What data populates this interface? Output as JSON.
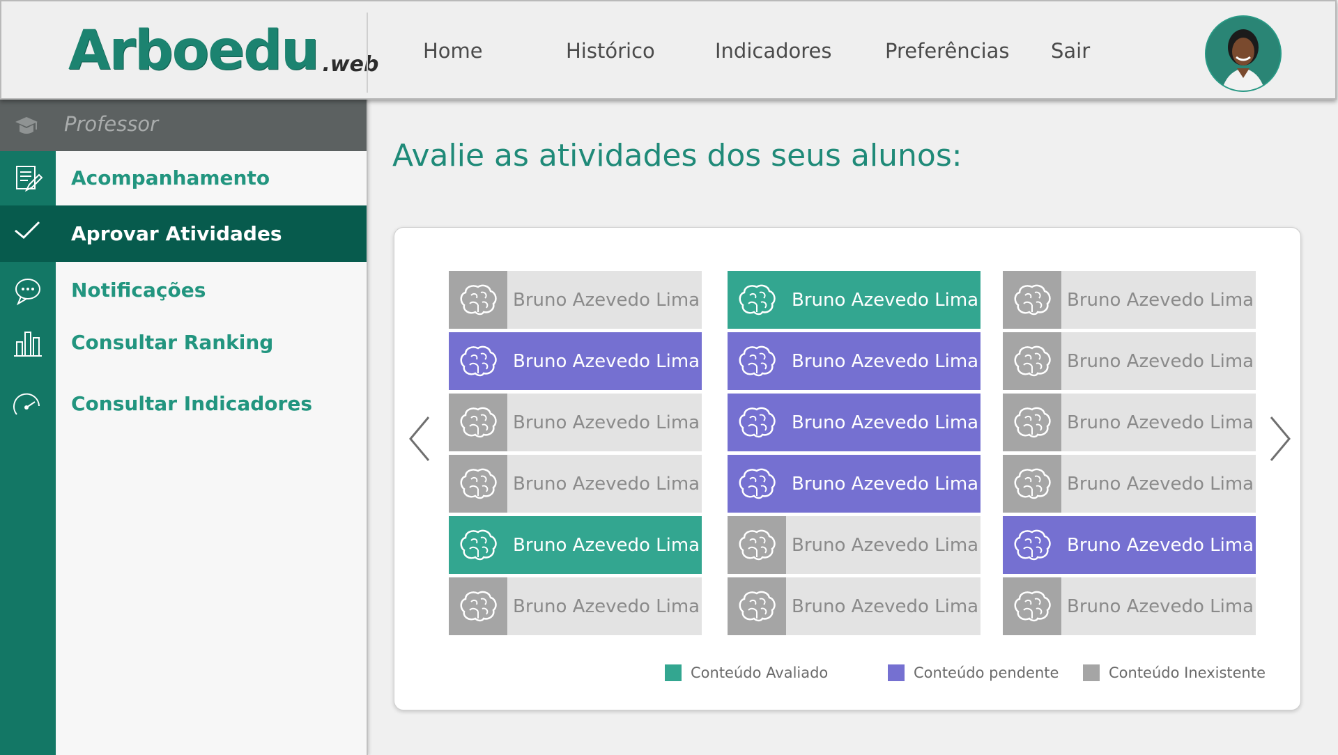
{
  "header": {
    "logo_main": "Arboedu",
    "logo_suffix": ".web",
    "nav": [
      "Home",
      "Histórico",
      "Indicadores",
      "Preferências",
      "Sair"
    ]
  },
  "sidebar": {
    "role": "Professor",
    "items": [
      {
        "label": "Acompanhamento",
        "icon": "edit-document-icon"
      },
      {
        "label": "Aprovar Atividades",
        "icon": "checkmark-icon"
      },
      {
        "label": "Notificações",
        "icon": "chat-bubble-icon"
      },
      {
        "label": "Consultar Ranking",
        "icon": "bar-chart-icon"
      },
      {
        "label": "Consultar Indicadores",
        "icon": "gauge-icon"
      }
    ]
  },
  "main": {
    "title": "Avalie as atividades dos seus alunos:",
    "columns": [
      [
        {
          "name": "Bruno Azevedo Lima",
          "status": "inexistente"
        },
        {
          "name": "Bruno Azevedo Lima",
          "status": "pendente"
        },
        {
          "name": "Bruno Azevedo Lima",
          "status": "inexistente"
        },
        {
          "name": "Bruno Azevedo Lima",
          "status": "inexistente"
        },
        {
          "name": "Bruno Azevedo Lima",
          "status": "avaliado"
        },
        {
          "name": "Bruno Azevedo Lima",
          "status": "inexistente"
        }
      ],
      [
        {
          "name": "Bruno Azevedo Lima",
          "status": "avaliado"
        },
        {
          "name": "Bruno Azevedo Lima",
          "status": "pendente"
        },
        {
          "name": "Bruno Azevedo Lima",
          "status": "pendente"
        },
        {
          "name": "Bruno Azevedo Lima",
          "status": "pendente"
        },
        {
          "name": "Bruno Azevedo Lima",
          "status": "inexistente"
        },
        {
          "name": "Bruno Azevedo Lima",
          "status": "inexistente"
        }
      ],
      [
        {
          "name": "Bruno Azevedo Lima",
          "status": "inexistente"
        },
        {
          "name": "Bruno Azevedo Lima",
          "status": "inexistente"
        },
        {
          "name": "Bruno Azevedo Lima",
          "status": "inexistente"
        },
        {
          "name": "Bruno Azevedo Lima",
          "status": "inexistente"
        },
        {
          "name": "Bruno Azevedo Lima",
          "status": "pendente"
        },
        {
          "name": "Bruno Azevedo Lima",
          "status": "inexistente"
        }
      ]
    ],
    "legend": [
      {
        "label": "Conteúdo Avaliado",
        "color": "#33a690"
      },
      {
        "label": "Conteúdo pendente",
        "color": "#7570d1"
      },
      {
        "label": "Conteúdo Inexistente",
        "color": "#a5a5a5"
      }
    ]
  },
  "colors": {
    "brand": "#1c8370",
    "sidebar_strip": "#137765",
    "active_item": "#075b4d",
    "role_bar": "#5c6161"
  }
}
